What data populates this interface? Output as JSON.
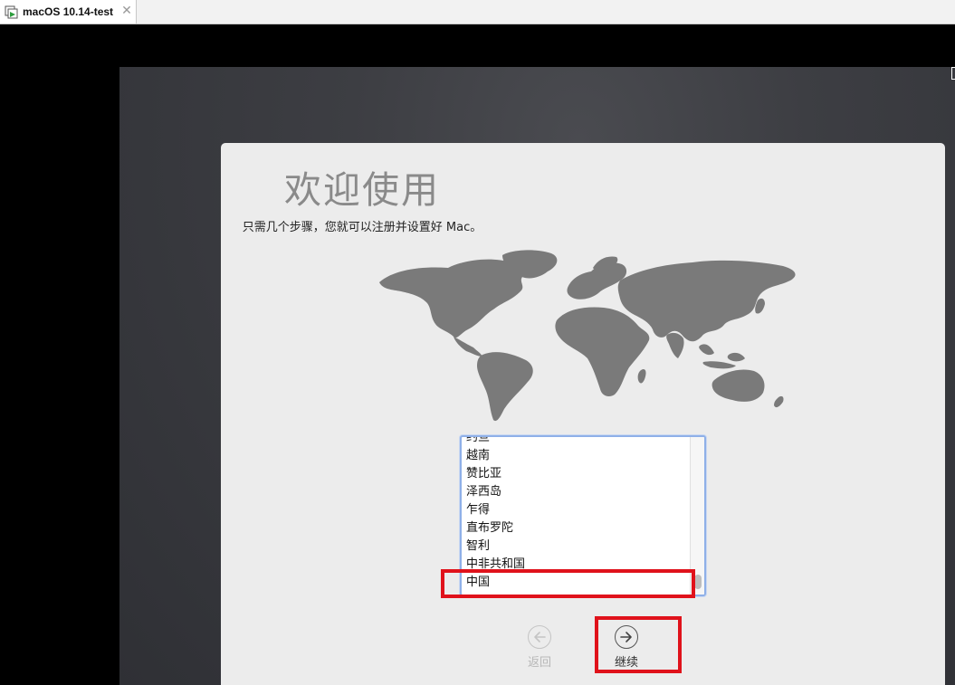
{
  "tab": {
    "title": "macOS 10.14-test",
    "close_glyph": "✕",
    "icon": "vm-tab-icon"
  },
  "setup": {
    "title": "欢迎使用",
    "subtitle": "只需几个步骤，您就可以注册并设置好 Mac。",
    "map_icon": "world-map",
    "countries": [
      "约旦",
      "越南",
      "赞比亚",
      "泽西岛",
      "乍得",
      "直布罗陀",
      "智利",
      "中非共和国",
      "中国"
    ],
    "selected_country": "中国",
    "back_label": "返回",
    "continue_label": "继续"
  },
  "colors": {
    "highlight": "#e0121b",
    "list_focus": "#8fb0e8",
    "dialog_bg": "#ececec"
  }
}
